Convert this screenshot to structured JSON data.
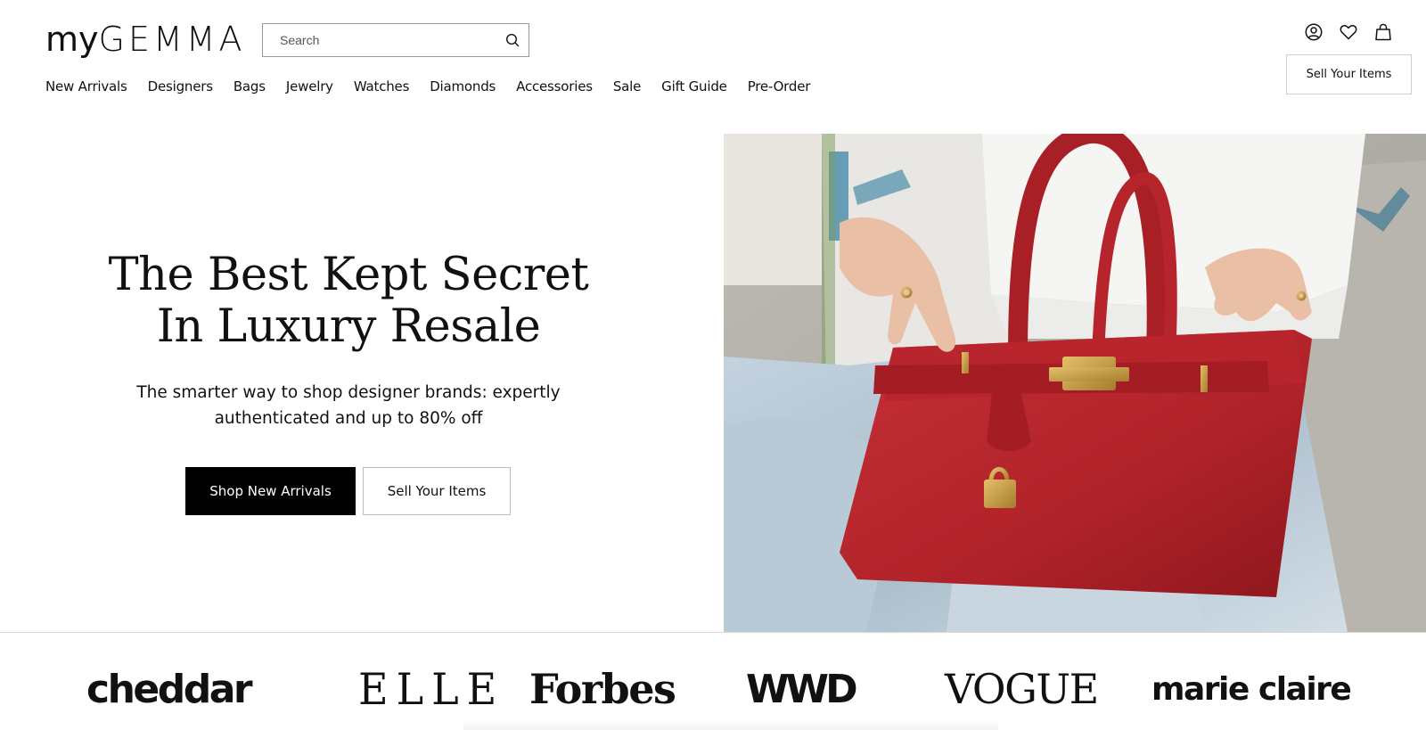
{
  "brand": {
    "logo_my": "my",
    "logo_gemma": "GEMMA"
  },
  "search": {
    "placeholder": "Search"
  },
  "nav": {
    "items": [
      "New Arrivals",
      "Designers",
      "Bags",
      "Jewelry",
      "Watches",
      "Diamonds",
      "Accessories",
      "Sale",
      "Gift Guide",
      "Pre-Order"
    ]
  },
  "header": {
    "icons": [
      "account-icon",
      "heart-icon",
      "shopping-bag-icon"
    ],
    "sell_label": "Sell Your Items"
  },
  "hero": {
    "title_line1": "The Best Kept Secret",
    "title_line2": "In Luxury Resale",
    "subtitle_line1": "The smarter way to shop designer brands: expertly",
    "subtitle_line2": "authenticated and up to 80% off",
    "primary_cta": "Shop New Arrivals",
    "secondary_cta": "Sell Your Items",
    "image_subject": "red-handbag-photo"
  },
  "press": {
    "logos": [
      "cheddar",
      "ELLE",
      "Forbes",
      "WWD",
      "VOGUE",
      "marie claire"
    ]
  },
  "colors": {
    "primary": "#000000",
    "background": "#ffffff",
    "bag_red": "#b8242a",
    "hardware_gold": "#c9a24a"
  }
}
